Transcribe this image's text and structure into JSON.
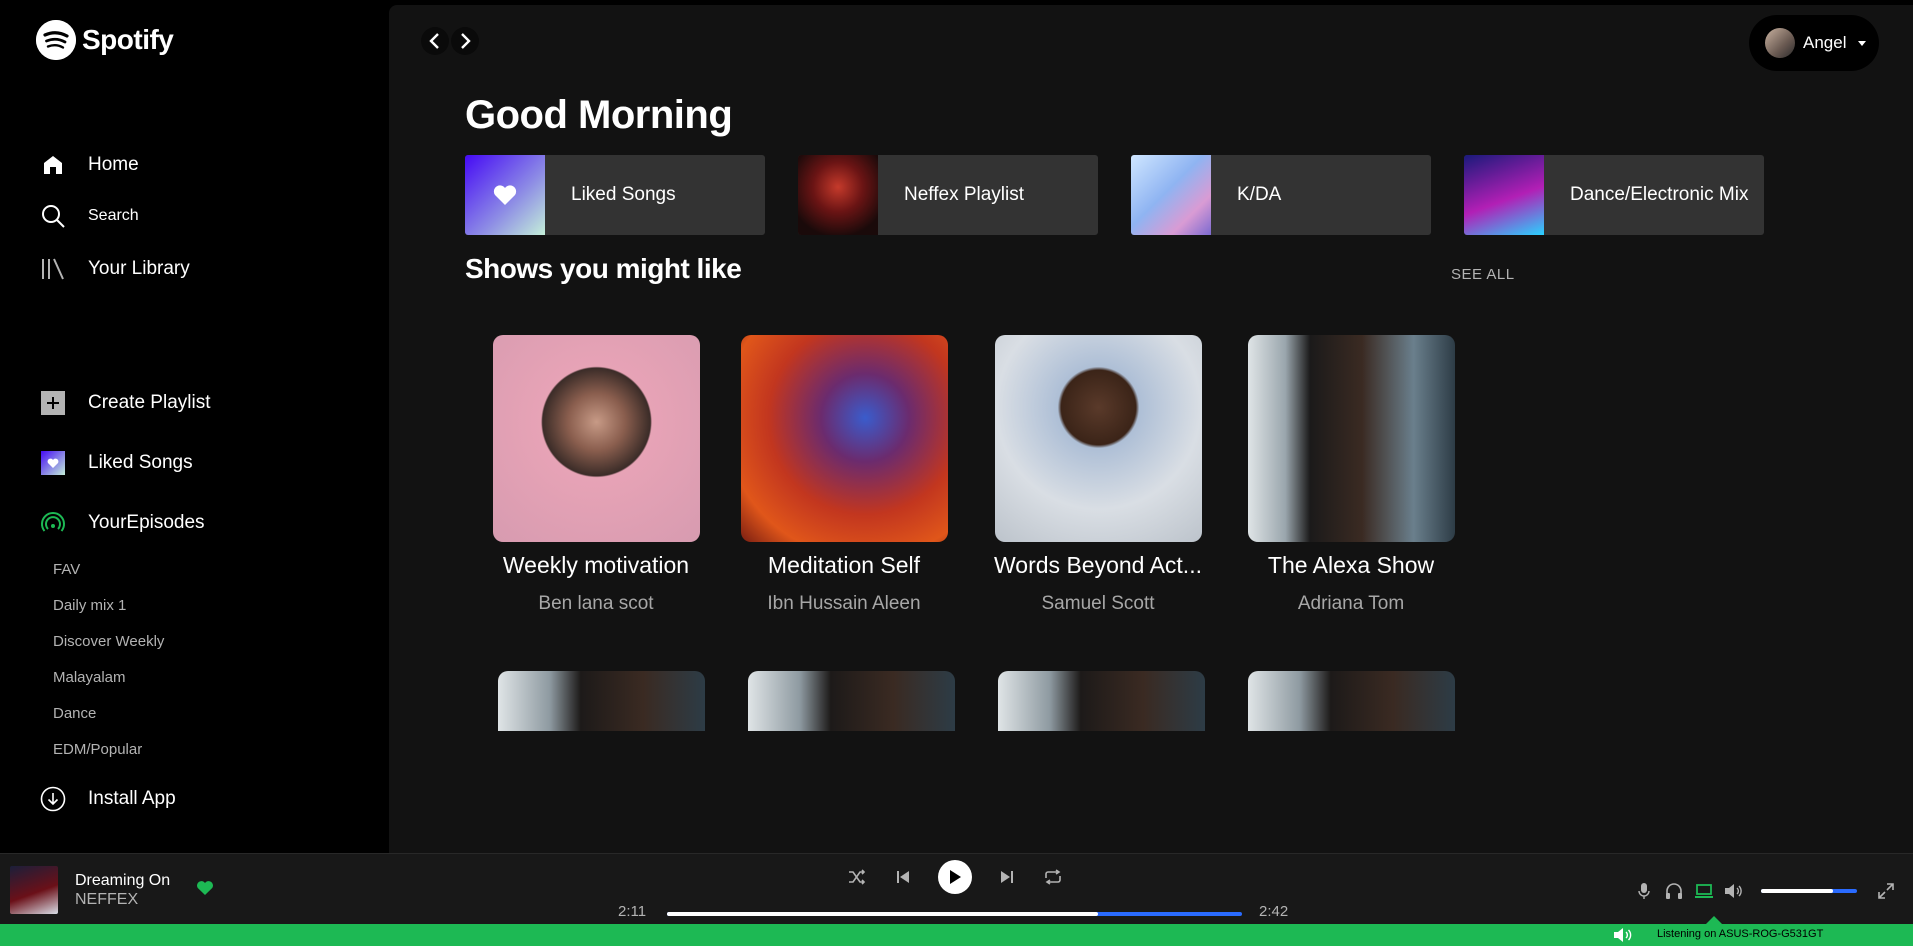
{
  "brand": {
    "name": "Spotify"
  },
  "sidebar": {
    "nav": [
      {
        "label": "Home",
        "icon": "home-icon"
      },
      {
        "label": "Search",
        "icon": "search-icon"
      },
      {
        "label": "Your Library",
        "icon": "library-icon"
      }
    ],
    "actions": [
      {
        "label": "Create Playlist",
        "icon": "plus-icon"
      },
      {
        "label": "Liked Songs",
        "icon": "heart-icon"
      },
      {
        "label": "YourEpisodes",
        "icon": "podcast-icon"
      }
    ],
    "playlists": [
      "FAV",
      "Daily mix 1",
      "Discover Weekly",
      "Malayalam",
      "Dance",
      "EDM/Popular"
    ],
    "install": {
      "label": "Install App",
      "icon": "download-icon"
    }
  },
  "header": {
    "user_name": "Angel"
  },
  "main": {
    "greeting": "Good Morning",
    "quick_access": [
      {
        "label": "Liked Songs"
      },
      {
        "label": "Neffex Playlist"
      },
      {
        "label": "K/DA"
      },
      {
        "label": "Dance/Electronic Mix"
      }
    ],
    "shows_title": "Shows you might like",
    "see_all": "SEE ALL",
    "shows": [
      {
        "title": "Weekly motivation",
        "subtitle": "Ben lana scot"
      },
      {
        "title": "Meditation Self",
        "subtitle": "Ibn Hussain Aleen"
      },
      {
        "title": "Words Beyond Act...",
        "subtitle": "Samuel Scott"
      },
      {
        "title": "The Alexa Show",
        "subtitle": "Adriana Tom"
      }
    ]
  },
  "player": {
    "track_title": "Dreaming On",
    "track_artist": "NEFFEX",
    "elapsed": "2:11",
    "duration": "2:42",
    "progress": 0.75,
    "volume": 0.75
  },
  "device": {
    "label": "Listening on ASUS-ROG-G531GT"
  },
  "colors": {
    "accent_green": "#1db954",
    "background": "#121212",
    "sidebar": "#000000",
    "card": "#333333",
    "progress_track": "#2a6bff"
  }
}
